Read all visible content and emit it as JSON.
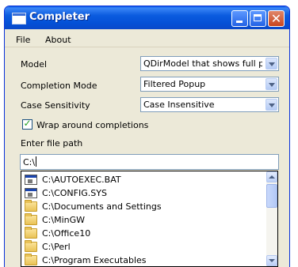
{
  "window": {
    "title": "Completer"
  },
  "menu": {
    "items": [
      "File",
      "About"
    ]
  },
  "form": {
    "model": {
      "label": "Model",
      "value": "QDirModel that shows full path"
    },
    "completion_mode": {
      "label": "Completion Mode",
      "value": "Filtered Popup"
    },
    "case_sensitivity": {
      "label": "Case Sensitivity",
      "value": "Case Insensitive"
    },
    "wrap": {
      "label": "Wrap around completions",
      "checked": true
    },
    "path_label": "Enter file path",
    "path_value": "C:\\"
  },
  "popup": {
    "items": [
      {
        "label": "C:\\AUTOEXEC.BAT",
        "icon": "bat-file-icon"
      },
      {
        "label": "C:\\CONFIG.SYS",
        "icon": "sys-file-icon"
      },
      {
        "label": "C:\\Documents and Settings",
        "icon": "folder-icon"
      },
      {
        "label": "C:\\MinGW",
        "icon": "folder-icon"
      },
      {
        "label": "C:\\Office10",
        "icon": "folder-icon"
      },
      {
        "label": "C:\\Perl",
        "icon": "folder-icon"
      },
      {
        "label": "C:\\Program Executables",
        "icon": "folder-icon"
      }
    ]
  },
  "colors": {
    "titlebar": "#0a5ae8",
    "window_bg": "#ece9d8",
    "close_button": "#c9461f",
    "check": "#21a121"
  }
}
